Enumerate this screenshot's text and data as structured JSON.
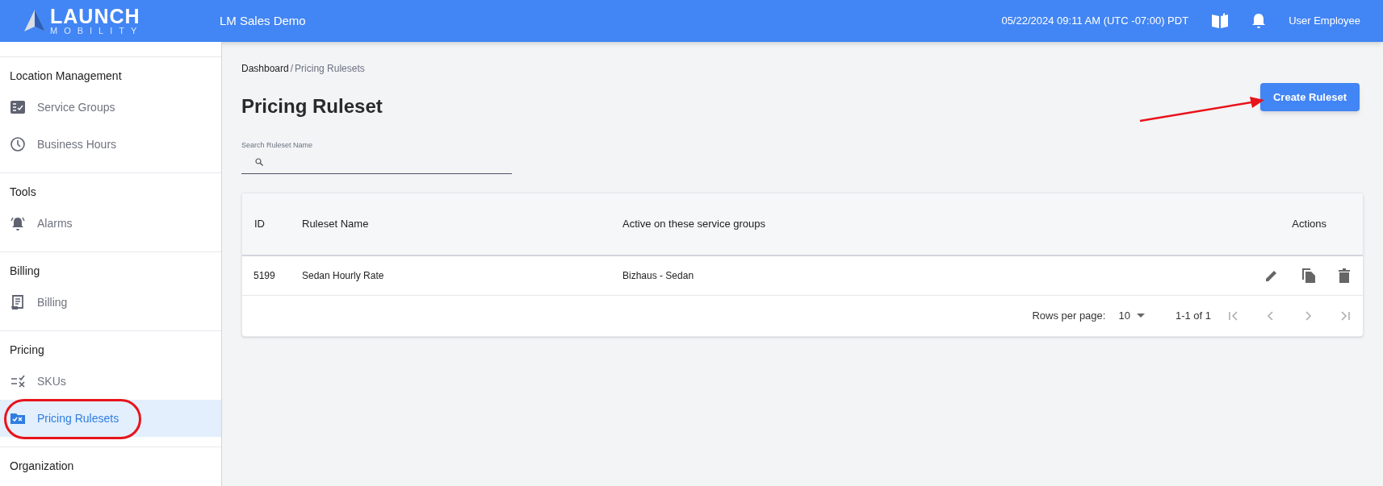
{
  "header": {
    "logo_word": "LAUNCH",
    "logo_subword": "MOBILITY",
    "app_name": "LM Sales Demo",
    "datetime": "05/22/2024 09:11 AM (UTC -07:00) PDT",
    "user": "User Employee"
  },
  "sidebar": {
    "sections": [
      {
        "title": "Location Management",
        "items": [
          {
            "label": "Service Groups",
            "kind": "checklist",
            "selected": false
          },
          {
            "label": "Business Hours",
            "kind": "clock",
            "selected": false
          }
        ]
      },
      {
        "title": "Tools",
        "items": [
          {
            "label": "Alarms",
            "kind": "alarm",
            "selected": false
          }
        ]
      },
      {
        "title": "Billing",
        "items": [
          {
            "label": "Billing",
            "kind": "receipt",
            "selected": false
          }
        ]
      },
      {
        "title": "Pricing",
        "items": [
          {
            "label": "SKUs",
            "kind": "rule",
            "selected": false
          },
          {
            "label": "Pricing Rulesets",
            "kind": "folder",
            "selected": true
          }
        ]
      },
      {
        "title": "Organization"
      }
    ]
  },
  "breadcrumb": {
    "link": "Dashboard",
    "separator": "/",
    "current": "Pricing Rulesets"
  },
  "page_title": "Pricing Ruleset",
  "create_button": "Create Ruleset",
  "search": {
    "label": "Search Ruleset Name"
  },
  "table": {
    "columns": [
      "ID",
      "Ruleset Name",
      "Active on these service groups",
      "Actions"
    ],
    "rows": [
      {
        "id": "5199",
        "name": "Sedan Hourly Rate",
        "groups": "Bizhaus - Sedan"
      }
    ],
    "footer": {
      "rows_per_page_label": "Rows per page:",
      "rows_per_page": "10",
      "range": "1-1 of 1"
    }
  },
  "annotations": {
    "ellipse": true,
    "arrow": true
  }
}
